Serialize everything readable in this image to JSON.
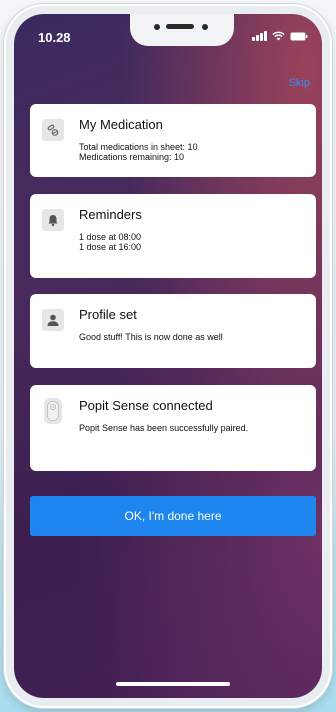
{
  "status_bar": {
    "time": "10.28"
  },
  "header": {
    "skip_label": "Skip"
  },
  "cards": [
    {
      "title": "My Medication",
      "lines": [
        "Total medications in sheet: 10",
        "Medications remaining: 10"
      ],
      "icon": "pills-icon"
    },
    {
      "title": "Reminders",
      "lines": [
        "1 dose at 08:00",
        "1 dose at 16:00"
      ],
      "icon": "bell-icon"
    },
    {
      "title": "Profile set",
      "lines": [
        "Good stuff! This is now done as well"
      ],
      "icon": "person-icon"
    },
    {
      "title": "Popit Sense connected",
      "lines": [
        "Popit Sense has been successfully paired."
      ],
      "icon": "device-icon"
    }
  ],
  "cta": {
    "label": "OK, I'm done here"
  },
  "colors": {
    "accent": "#1f86ef",
    "skip": "#3a8ef6"
  }
}
